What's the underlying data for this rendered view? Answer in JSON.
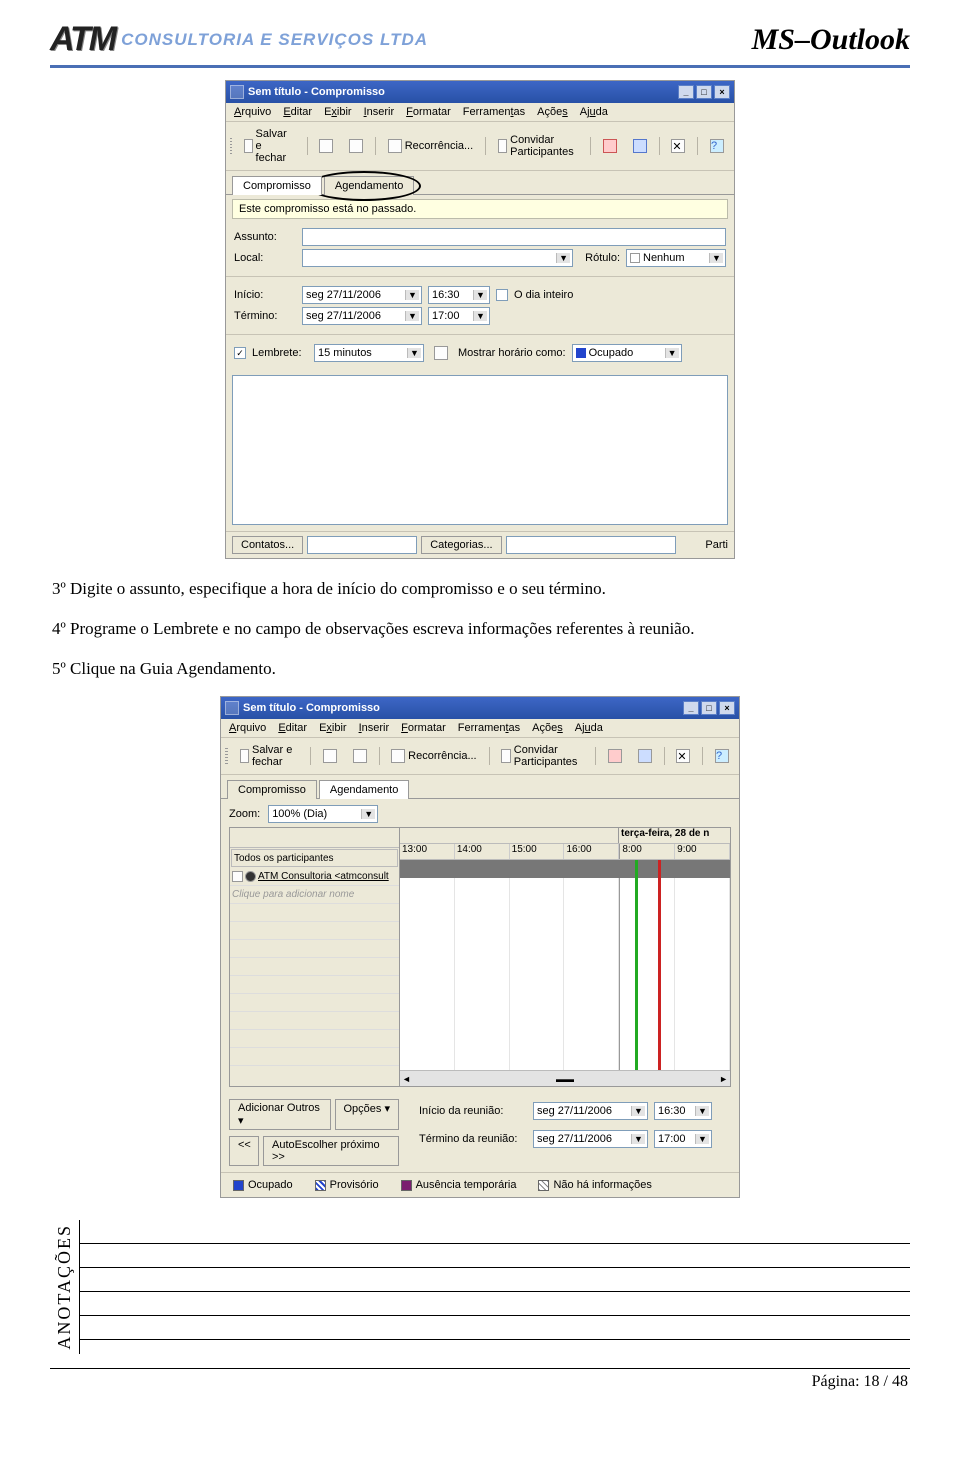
{
  "header": {
    "logo_main": "ATM",
    "logo_sub": "CONSULTORIA E SERVIÇOS LTDA",
    "title": "MS–Outlook"
  },
  "screenshot1": {
    "title": "Sem título - Compromisso",
    "menus": [
      "Arquivo",
      "Editar",
      "Exibir",
      "Inserir",
      "Formatar",
      "Ferramentas",
      "Ações",
      "Ajuda"
    ],
    "toolbar": {
      "save_close": "Salvar e fechar",
      "recurrence": "Recorrência...",
      "invite": "Convidar Participantes"
    },
    "tabs": {
      "appointment": "Compromisso",
      "scheduling": "Agendamento"
    },
    "info_bar": "Este compromisso está no passado.",
    "labels": {
      "subject": "Assunto:",
      "location": "Local:",
      "label": "Rótulo:",
      "start": "Início:",
      "end": "Término:",
      "allday": "O dia inteiro",
      "reminder": "Lembrete:",
      "show_as": "Mostrar horário como:"
    },
    "values": {
      "label_val": "Nenhum",
      "start_date": "seg 27/11/2006",
      "start_time": "16:30",
      "end_date": "seg 27/11/2006",
      "end_time": "17:00",
      "reminder_val": "15 minutos",
      "show_as_val": "Ocupado"
    },
    "bottom": {
      "contacts": "Contatos...",
      "categories": "Categorias...",
      "parti": "Parti"
    }
  },
  "step3": "3º Digite o assunto, especifique a hora de início do compromisso e o seu término.",
  "step4": "4º Programe o Lembrete e no campo de observações escreva informações referentes à reunião.",
  "step5": "5º Clique na Guia Agendamento.",
  "screenshot2": {
    "title": "Sem título - Compromisso",
    "menus": [
      "Arquivo",
      "Editar",
      "Exibir",
      "Inserir",
      "Formatar",
      "Ferramentas",
      "Ações",
      "Ajuda"
    ],
    "toolbar": {
      "save_close": "Salvar e fechar",
      "recurrence": "Recorrência...",
      "invite": "Convidar Participantes"
    },
    "tabs": {
      "appointment": "Compromisso",
      "scheduling": "Agendamento"
    },
    "zoom_label": "Zoom:",
    "zoom_value": "100% (Dia)",
    "day_header_right": "terça-feira, 28 de n",
    "time_headers": [
      "13:00",
      "14:00",
      "15:00",
      "16:00",
      "8:00",
      "9:00"
    ],
    "participants_header": "Todos os participantes",
    "participant1": "ATM Consultoria <atmconsult",
    "participant_add": "Clique para adicionar nome",
    "add_others": "Adicionar Outros",
    "options": "Opções",
    "autopick_prev": "<<",
    "autopick_next": "AutoEscolher próximo >>",
    "start_label": "Início da reunião:",
    "end_label": "Término da reunião:",
    "start_date": "seg 27/11/2006",
    "start_time": "16:30",
    "end_date": "seg 27/11/2006",
    "end_time": "17:00",
    "legend": {
      "busy": "Ocupado",
      "tentative": "Provisório",
      "oof": "Ausência temporária",
      "noinfo": "Não há informações"
    }
  },
  "notes_label": "ANOTAÇÕES",
  "footer": "Página: 18 / 48"
}
